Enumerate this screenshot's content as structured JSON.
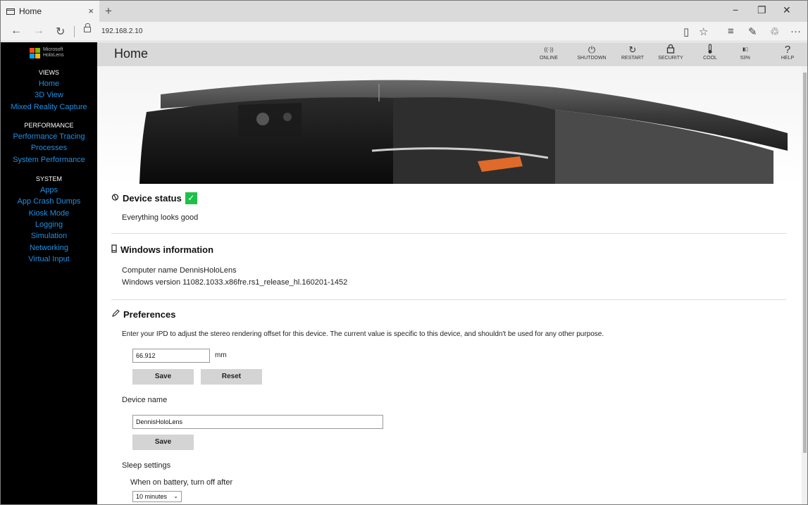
{
  "browser": {
    "tab_title": "Home",
    "tab_close": "×",
    "new_tab": "+",
    "window_controls": {
      "minimize": "−",
      "maximize": "❐",
      "close": "✕"
    },
    "back": "←",
    "forward": "→",
    "refresh": "↻",
    "url": "192.168.2.10",
    "toolbar_icons": [
      "reading-view-icon",
      "favorite-star-icon",
      "hub-icon",
      "web-note-icon",
      "share-icon",
      "more-icon"
    ],
    "toolbar_glyphs": {
      "reading": "▯",
      "star": "☆",
      "hub": "≡",
      "note": "✎",
      "share": "♲",
      "more": "···"
    }
  },
  "sidebar": {
    "logo_line1": "Microsoft",
    "logo_line2": "HoloLens",
    "logo_colors": [
      "#f25022",
      "#7fba00",
      "#00a4ef",
      "#ffb900"
    ],
    "sections": [
      {
        "heading": "VIEWS",
        "items": [
          "Home",
          "3D View",
          "Mixed Reality Capture"
        ]
      },
      {
        "heading": "PERFORMANCE",
        "items": [
          "Performance Tracing",
          "Processes",
          "System Performance"
        ]
      },
      {
        "heading": "SYSTEM",
        "items": [
          "Apps",
          "App Crash Dumps",
          "Kiosk Mode",
          "Logging",
          "Simulation",
          "Networking",
          "Virtual Input"
        ]
      }
    ],
    "link_color": "#1e90e6"
  },
  "header": {
    "title": "Home",
    "buttons": [
      {
        "label": "ONLINE",
        "icon": "online-icon",
        "glyph": "((·))"
      },
      {
        "label": "SHUTDOWN",
        "icon": "power-icon",
        "glyph": "⏻"
      },
      {
        "label": "RESTART",
        "icon": "restart-icon",
        "glyph": "↻"
      },
      {
        "label": "SECURITY",
        "icon": "lock-icon",
        "glyph": "🔒︎"
      },
      {
        "label": "COOL",
        "icon": "thermometer-icon",
        "glyph": "🌡︎"
      },
      {
        "label": "53%",
        "icon": "battery-icon",
        "glyph": "▮▯"
      },
      {
        "label": "HELP",
        "icon": "help-icon",
        "glyph": "?"
      }
    ]
  },
  "device_status": {
    "title": "Device status",
    "icon": "status-icon",
    "check": "✓",
    "message": "Everything looks good"
  },
  "windows_info": {
    "title": "Windows information",
    "icon": "device-icon",
    "computer_name_label": "Computer name",
    "computer_name": "DennisHoloLens",
    "windows_version_label": "Windows version",
    "windows_version": "11082.1033.x86fre.rs1_release_hl.160201-1452"
  },
  "preferences": {
    "title": "Preferences",
    "icon": "pencil-icon",
    "ipd_description": "Enter your IPD to adjust the stereo rendering offset for this device. The current value is specific to this device, and shouldn't be used for any other purpose.",
    "ipd_value": "66.912",
    "ipd_unit": "mm",
    "save_label": "Save",
    "reset_label": "Reset",
    "device_name_label": "Device name",
    "device_name_value": "DennisHoloLens",
    "device_save_label": "Save",
    "sleep_label": "Sleep settings",
    "battery_label": "When on battery, turn off after",
    "battery_select": "10 minutes"
  }
}
